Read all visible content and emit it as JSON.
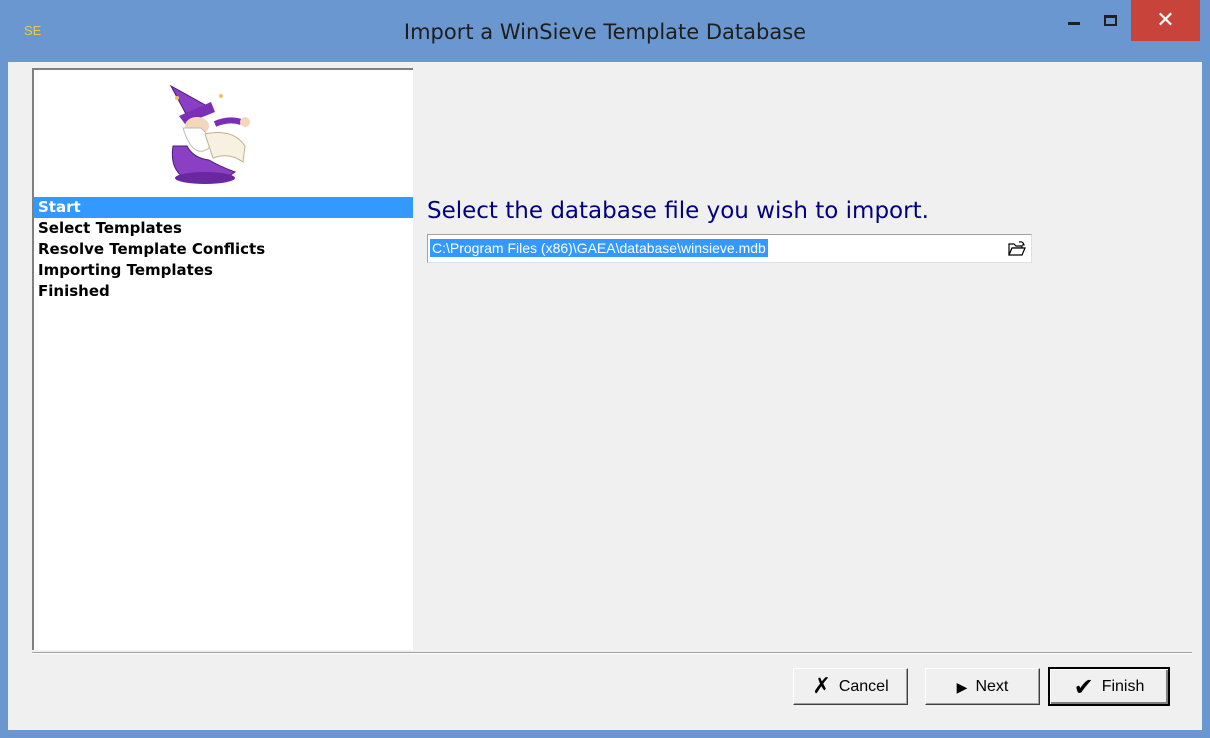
{
  "window": {
    "app_icon": "SE",
    "title": "Import a WinSieve Template Database",
    "controls": {
      "minimize_icon": "minimize-icon",
      "maximize_icon": "maximize-icon",
      "close_glyph": "✕"
    }
  },
  "sidebar": {
    "image": "wizard-icon",
    "steps": [
      {
        "label": "Start",
        "active": true
      },
      {
        "label": "Select Templates",
        "active": false
      },
      {
        "label": "Resolve Template Conflicts",
        "active": false
      },
      {
        "label": "Importing Templates",
        "active": false
      },
      {
        "label": "Finished",
        "active": false
      }
    ]
  },
  "main": {
    "prompt": "Select the database file you wish to import.",
    "file_path": "C:\\Program Files (x86)\\GAEA\\database\\winsieve.mdb",
    "browse_icon": "open-folder-icon"
  },
  "buttons": {
    "cancel": "Cancel",
    "next": "Next",
    "finish": "Finish"
  },
  "colors": {
    "titlebar": "#6a97cf",
    "selection": "#3399ff",
    "prompt_text": "#000080",
    "close_button": "#c8433a"
  }
}
